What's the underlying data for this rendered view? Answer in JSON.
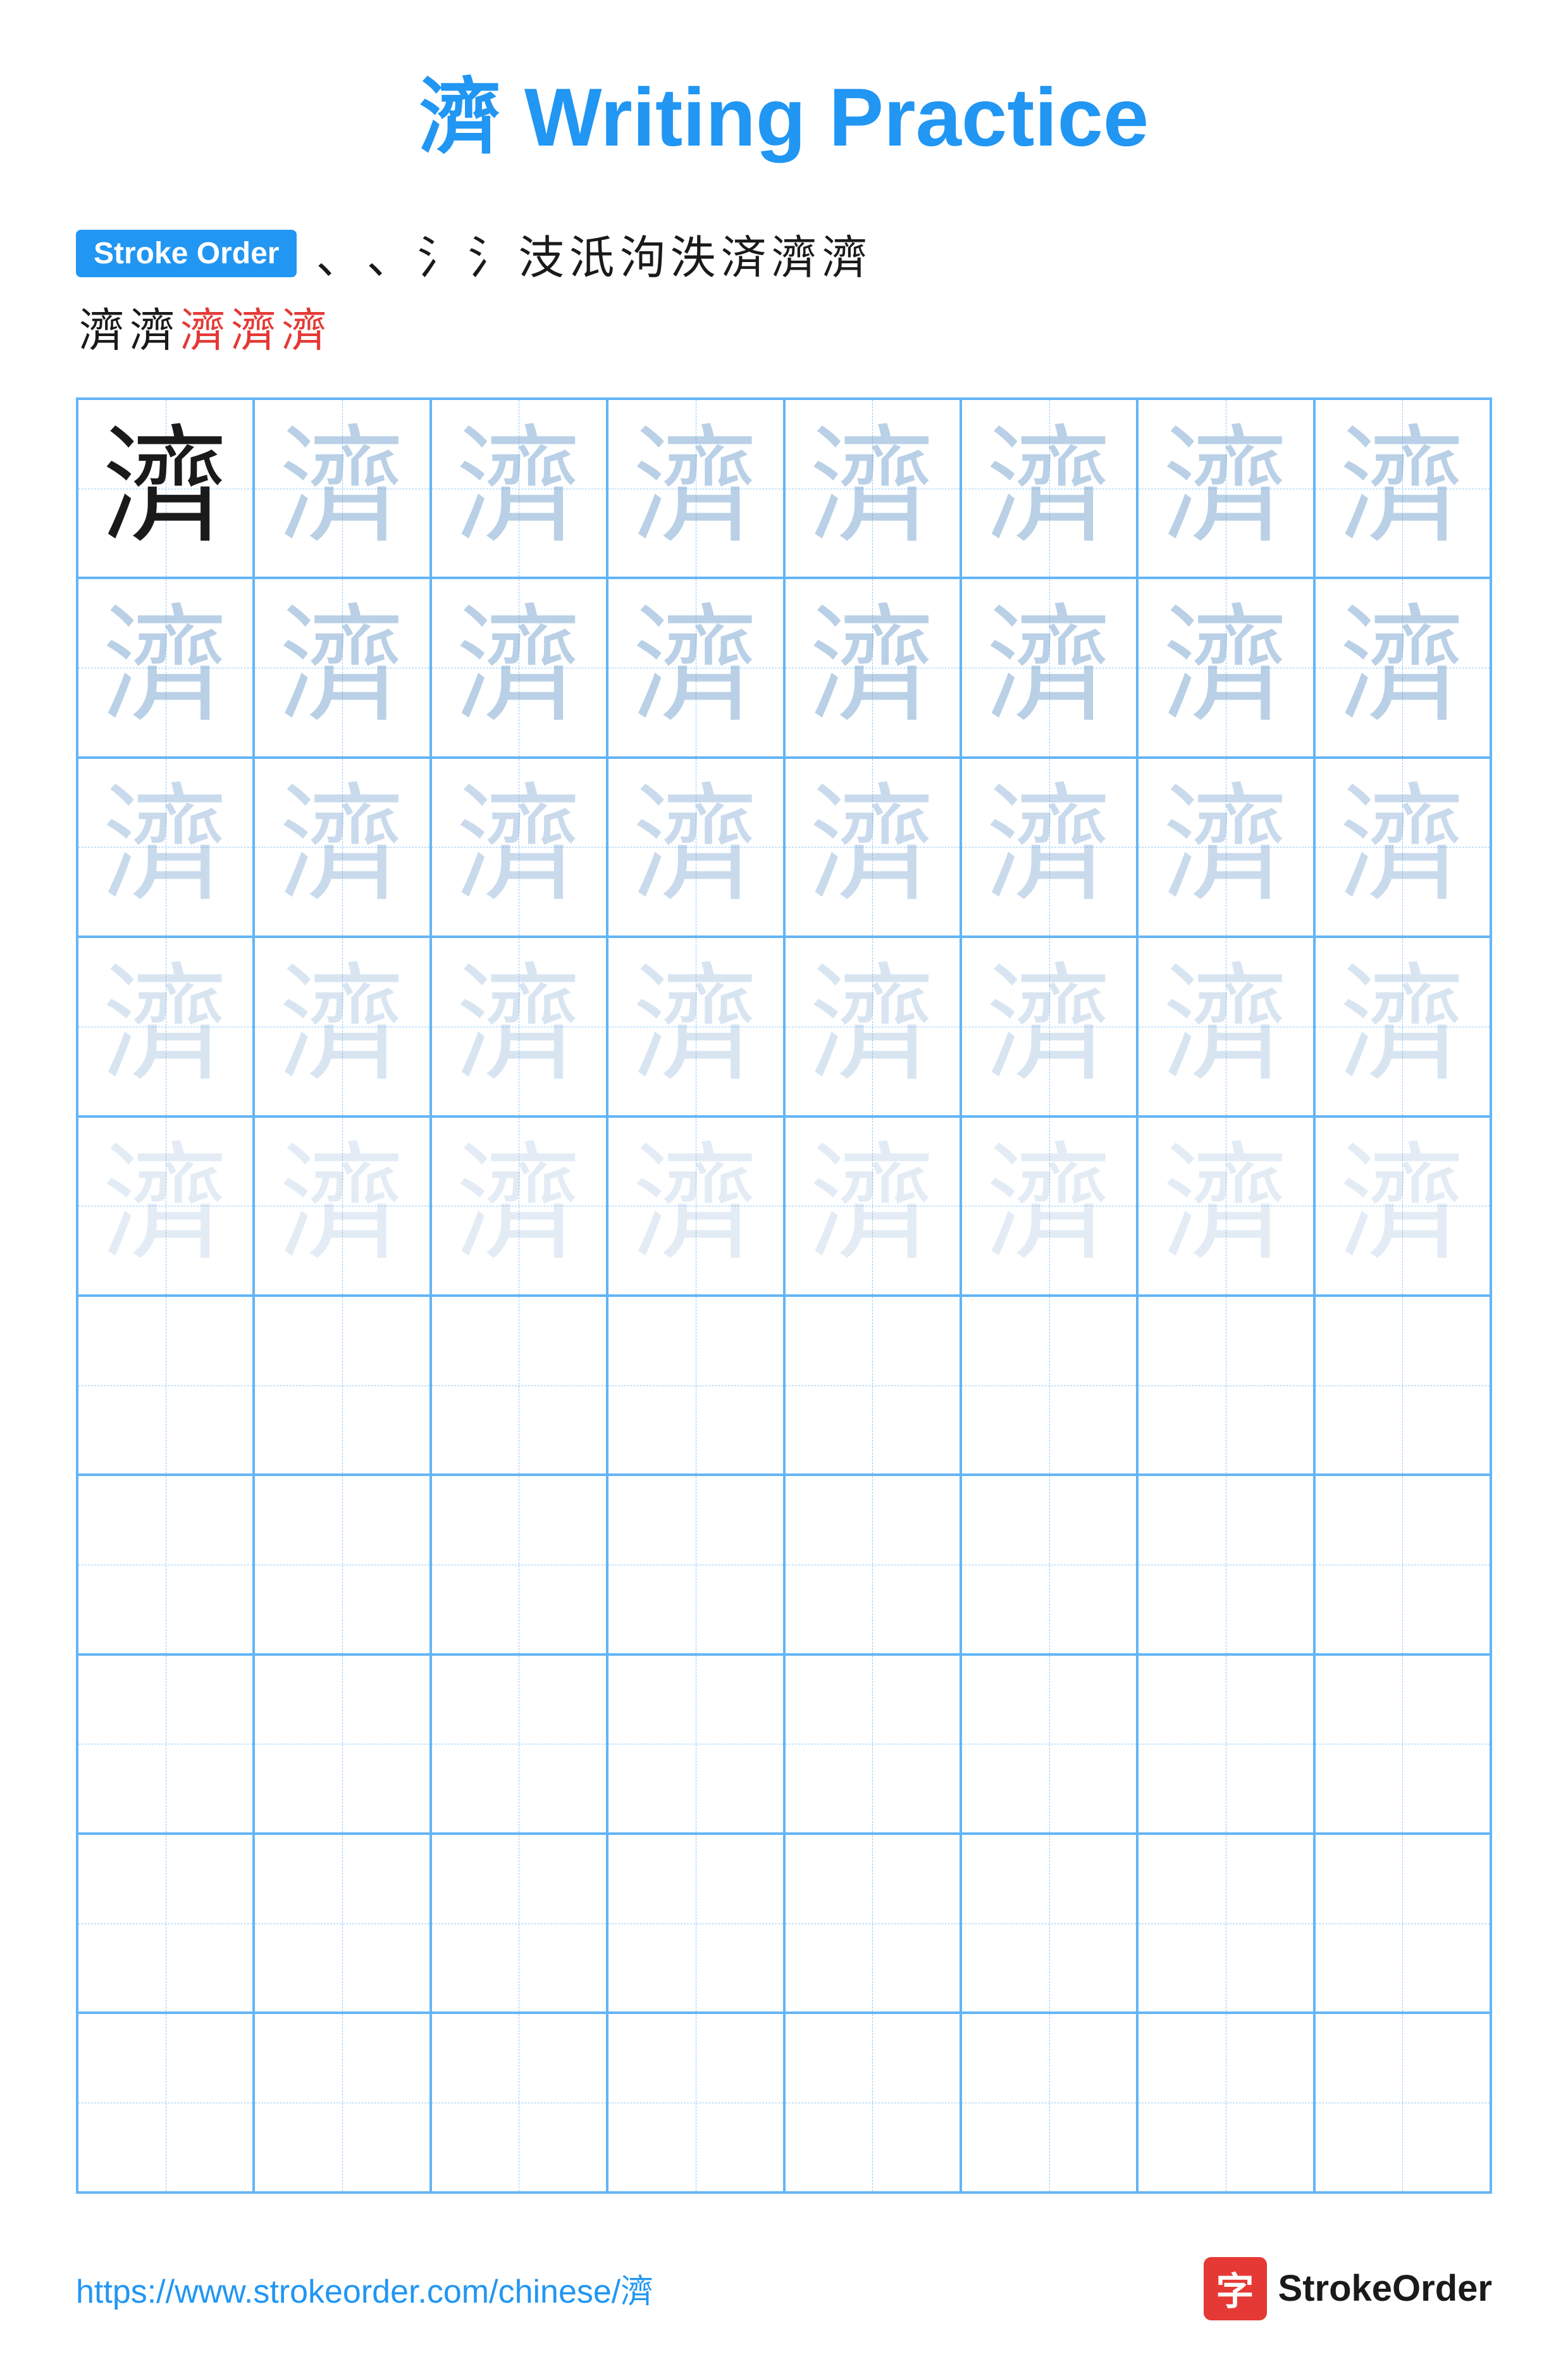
{
  "title": {
    "char": "濟",
    "text": " Writing Practice"
  },
  "stroke_order": {
    "badge_label": "Stroke Order",
    "row1_chars": [
      "、",
      "、",
      "氵",
      "氵",
      "泀",
      "泃",
      "泆",
      "泇",
      "済",
      "濟",
      "濟"
    ],
    "row2_chars": [
      "濟",
      "濟",
      "濟",
      "濟",
      "濟"
    ]
  },
  "practice_char": "濟",
  "grid": {
    "cols": 8,
    "rows": 10,
    "char_rows": [
      [
        "dark",
        "light1",
        "light1",
        "light1",
        "light1",
        "light1",
        "light1",
        "light1"
      ],
      [
        "light1",
        "light1",
        "light1",
        "light1",
        "light1",
        "light1",
        "light1",
        "light1"
      ],
      [
        "light2",
        "light2",
        "light2",
        "light2",
        "light2",
        "light2",
        "light2",
        "light2"
      ],
      [
        "light3",
        "light3",
        "light3",
        "light3",
        "light3",
        "light3",
        "light3",
        "light3"
      ],
      [
        "light4",
        "light4",
        "light4",
        "light4",
        "light4",
        "light4",
        "light4",
        "light4"
      ],
      [
        "empty",
        "empty",
        "empty",
        "empty",
        "empty",
        "empty",
        "empty",
        "empty"
      ],
      [
        "empty",
        "empty",
        "empty",
        "empty",
        "empty",
        "empty",
        "empty",
        "empty"
      ],
      [
        "empty",
        "empty",
        "empty",
        "empty",
        "empty",
        "empty",
        "empty",
        "empty"
      ],
      [
        "empty",
        "empty",
        "empty",
        "empty",
        "empty",
        "empty",
        "empty",
        "empty"
      ],
      [
        "empty",
        "empty",
        "empty",
        "empty",
        "empty",
        "empty",
        "empty",
        "empty"
      ]
    ]
  },
  "footer": {
    "url": "https://www.strokeorder.com/chinese/濟",
    "brand_char": "字",
    "brand_name": "StrokeOrder"
  }
}
